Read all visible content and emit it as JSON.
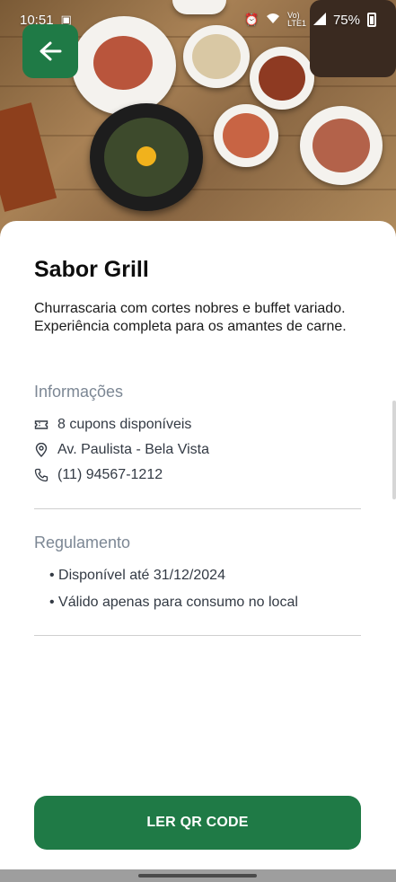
{
  "status_bar": {
    "time": "10:51",
    "battery": "75%",
    "icons": [
      "screenshot-icon",
      "alarm-icon",
      "wifi-icon",
      "volte-icon",
      "signal-icon",
      "battery-icon"
    ]
  },
  "hero": {
    "image": "korean-food-table-photo"
  },
  "back_button": {
    "icon": "arrow-left-icon"
  },
  "restaurant": {
    "name": "Sabor Grill",
    "description": "Churrascaria com cortes nobres e buffet variado. Experiência completa para os amantes de carne."
  },
  "info": {
    "title": "Informações",
    "items": [
      {
        "icon": "ticket-icon",
        "text": "8 cupons disponíveis"
      },
      {
        "icon": "location-pin-icon",
        "text": "Av. Paulista - Bela Vista"
      },
      {
        "icon": "phone-icon",
        "text": "(11) 94567-1212"
      }
    ]
  },
  "rules": {
    "title": "Regulamento",
    "items": [
      "• Disponível até 31/12/2024",
      "• Válido apenas para consumo no local"
    ]
  },
  "qr_button": {
    "label": "LER QR CODE"
  },
  "colors": {
    "accent": "#1f7a46",
    "section_title": "#7c8794",
    "text": "#333a44"
  }
}
